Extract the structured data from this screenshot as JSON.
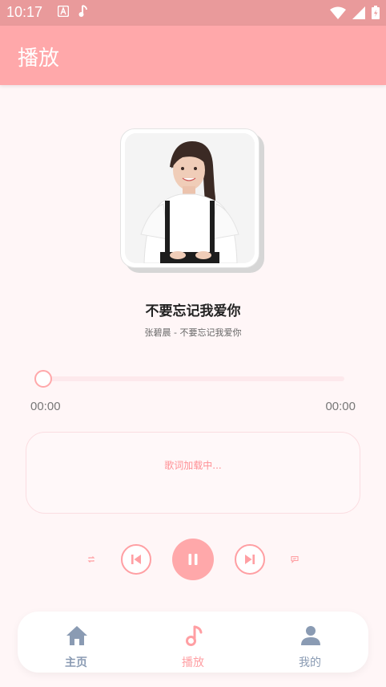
{
  "status_bar": {
    "time": "10:17",
    "icons_left": [
      "a-icon",
      "music-note-icon"
    ],
    "icons_right": [
      "wifi-icon",
      "signal-icon",
      "battery-icon"
    ]
  },
  "app_bar": {
    "title": "播放"
  },
  "player": {
    "song_title": "不要忘记我爱你",
    "song_subtitle": "张碧晨 - 不要忘记我爱你",
    "progress": 0,
    "time_current": "00:00",
    "time_total": "00:00",
    "lyrics_status": "歌词加载中..."
  },
  "controls": [
    "repeat-icon",
    "previous-icon",
    "pause-icon",
    "next-icon",
    "comment-icon"
  ],
  "bottom_nav": {
    "items": [
      {
        "label": "主页",
        "icon": "home-icon",
        "active": false
      },
      {
        "label": "播放",
        "icon": "music-note-icon",
        "active": true
      },
      {
        "label": "我的",
        "icon": "person-icon",
        "active": false
      }
    ]
  },
  "colors": {
    "accent": "#ffa8aa",
    "status_bar": "#e99a9b",
    "background": "#fff6f7",
    "nav_inactive": "#8a9bb3",
    "nav_active": "#ff9fa3"
  }
}
